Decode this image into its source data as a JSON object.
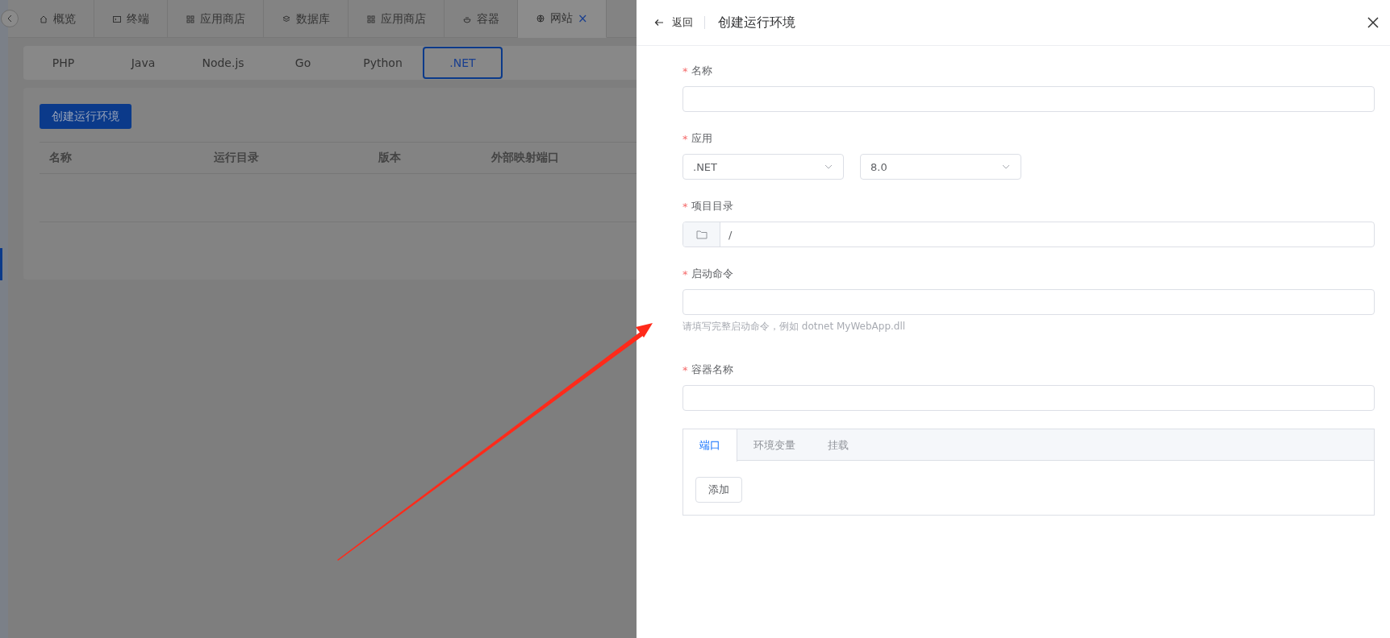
{
  "page_tabs": [
    {
      "label": "概览",
      "selected": false,
      "closable": false
    },
    {
      "label": "终端",
      "selected": false,
      "closable": false
    },
    {
      "label": "应用商店",
      "selected": false,
      "closable": false
    },
    {
      "label": "数据库",
      "selected": false,
      "closable": false
    },
    {
      "label": "应用商店",
      "selected": false,
      "closable": false
    },
    {
      "label": "容器",
      "selected": false,
      "closable": false
    },
    {
      "label": "网站",
      "selected": true,
      "closable": true,
      "close": "×"
    }
  ],
  "runtime_tabs": [
    {
      "label": "PHP",
      "selected": false
    },
    {
      "label": "Java",
      "selected": false
    },
    {
      "label": "Node.js",
      "selected": false
    },
    {
      "label": "Go",
      "selected": false
    },
    {
      "label": "Python",
      "selected": false
    },
    {
      "label": ".NET",
      "selected": true
    }
  ],
  "create_button": "创建运行环境",
  "table": {
    "columns": [
      "名称",
      "运行目录",
      "版本",
      "外部映射端口"
    ]
  },
  "drawer": {
    "back": "返回",
    "title": "创建运行环境",
    "fields": [
      {
        "kind": "input",
        "label": "名称",
        "required_mark": "*"
      },
      {
        "kind": "selects",
        "label": "应用",
        "required_mark": "*",
        "selects": [
          ".NET",
          "8.0"
        ]
      },
      {
        "kind": "path",
        "label": "项目目录",
        "required_mark": "*",
        "value": "/"
      },
      {
        "kind": "input",
        "label": "启动命令",
        "required_mark": "*",
        "help": "请填写完整启动命令，例如 dotnet MyWebApp.dll"
      },
      {
        "kind": "input",
        "label": "容器名称",
        "required_mark": "*"
      }
    ],
    "panel": {
      "tabs": [
        {
          "label": "端口",
          "selected": true
        },
        {
          "label": "环境变量",
          "selected": false
        },
        {
          "label": "挂载",
          "selected": false
        }
      ],
      "button": "添加"
    }
  }
}
